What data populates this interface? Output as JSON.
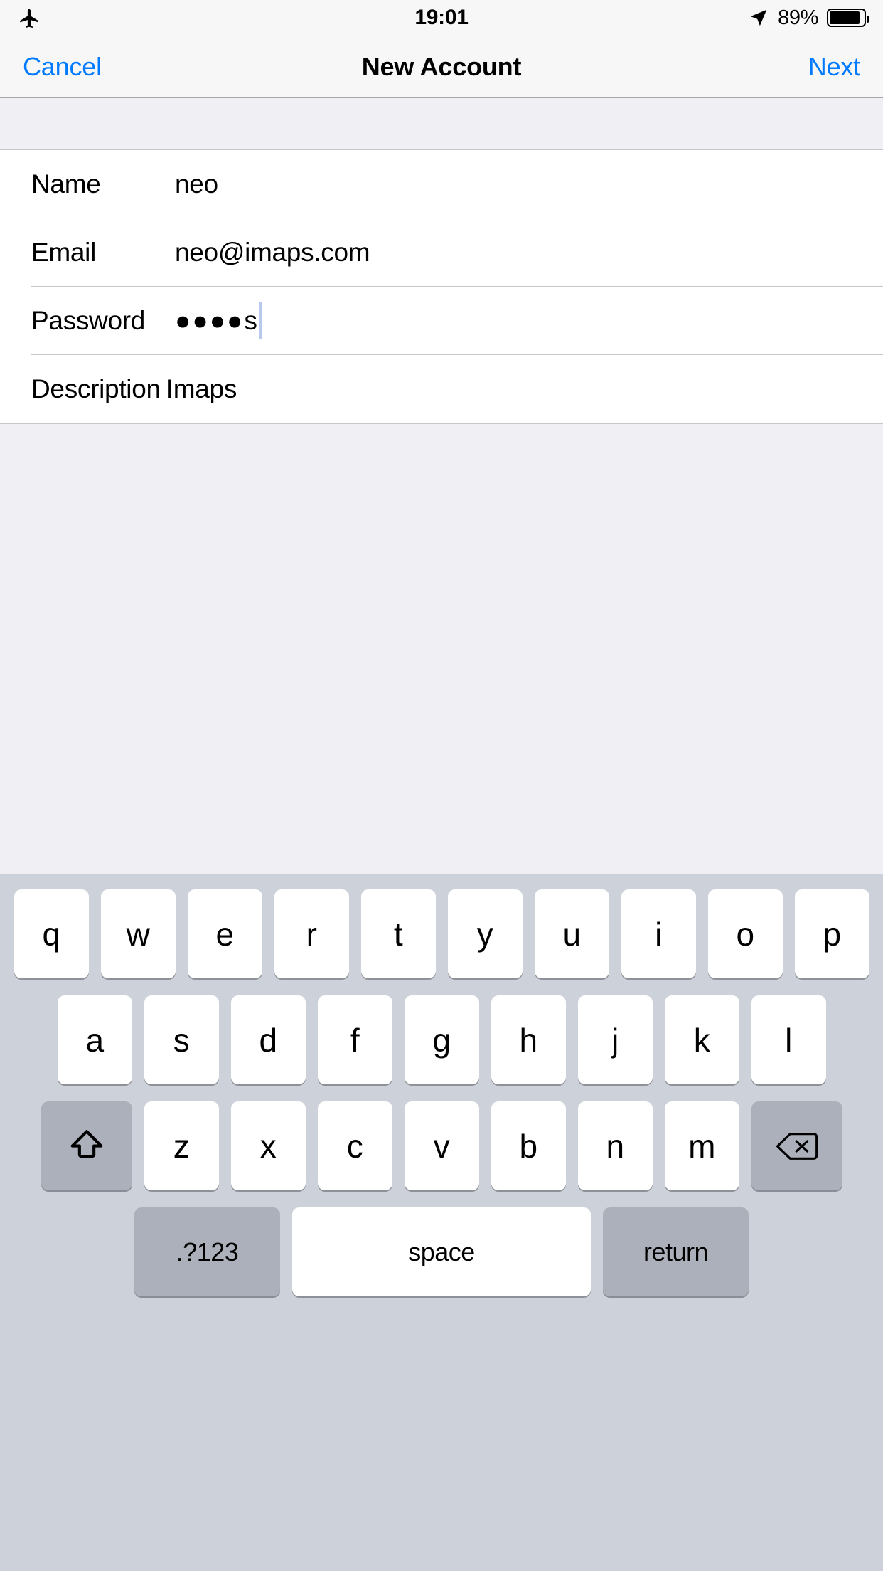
{
  "status_bar": {
    "airplane_icon": "airplane-mode-icon",
    "time": "19:01",
    "location_icon": "location-arrow-icon",
    "battery_percent": "89%",
    "battery_level": 89
  },
  "nav_bar": {
    "cancel_label": "Cancel",
    "title": "New Account",
    "next_label": "Next",
    "accent_color": "#007AFF"
  },
  "form": {
    "rows": [
      {
        "label": "Name",
        "value": "neo"
      },
      {
        "label": "Email",
        "value": "neo@imaps.com"
      },
      {
        "label": "Password",
        "value": "●●●● s",
        "masked_dots": "●●●●",
        "visible_char": "s",
        "has_caret": true
      },
      {
        "label": "Description",
        "value": "Imaps"
      }
    ]
  },
  "keyboard": {
    "row1": [
      "q",
      "w",
      "e",
      "r",
      "t",
      "y",
      "u",
      "i",
      "o",
      "p"
    ],
    "row2": [
      "a",
      "s",
      "d",
      "f",
      "g",
      "h",
      "j",
      "k",
      "l"
    ],
    "row3_letters": [
      "z",
      "x",
      "c",
      "v",
      "b",
      "n",
      "m"
    ],
    "shift_icon": "shift-arrow-icon",
    "delete_icon": "delete-backspace-icon",
    "numeric_label": ".?123",
    "space_label": "space",
    "return_label": "return",
    "key_bg": "#FFFFFF",
    "modifier_bg": "#ABB0BA",
    "keyboard_bg": "#CDD1D9"
  }
}
